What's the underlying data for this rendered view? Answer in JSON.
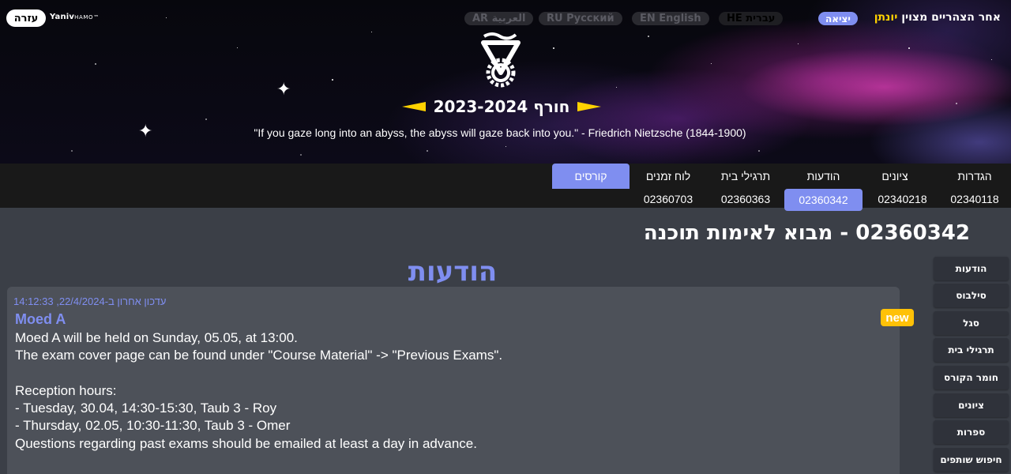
{
  "header": {
    "help_label": "עזרה",
    "creator_name": "Yaniv",
    "creator_sub": "HAMO",
    "creator_mark": "™",
    "languages": [
      {
        "label": "AR العربية",
        "active": false
      },
      {
        "label": "RU Русский",
        "active": false
      },
      {
        "label": "EN English",
        "active": false
      },
      {
        "label": "HE עברית",
        "active": true
      }
    ],
    "logout_label": "יציאה",
    "greeting_prefix": "אחר הצהריים מצוין",
    "user_name": "יונתן",
    "semester_title": "חורף 2023-2024",
    "quote": "\"If you gaze long into an abyss, the abyss will gaze back into you.\" - Friedrich Nietzsche (1844-1900)"
  },
  "nav": {
    "courses_label": "קורסים",
    "top_items": [
      "הגדרות",
      "ציונים",
      "הודעות",
      "תרגילי בית",
      "לוח זמנים"
    ],
    "course_numbers": [
      "02340118",
      "02340218",
      "02360342",
      "02360363",
      "02360703"
    ],
    "active_course": "02360342"
  },
  "course": {
    "title": "02360342 - מבוא לאימות תוכנה"
  },
  "sidebar": {
    "items": [
      "הודעות",
      "סילבוס",
      "סגל",
      "תרגילי בית",
      "חומר הקורס",
      "ציונים",
      "ספרות",
      "חיפוש שותפים"
    ]
  },
  "announcements": {
    "heading": "הודעות",
    "new_badge": "new",
    "items": [
      {
        "updated": "עדכון אחרון ב-22/4/2024, 14:12:33",
        "title": "Moed A",
        "lines": [
          "Moed A will be held on Sunday, 05.05, at 13:00.",
          "The exam cover page can be found under \"Course Material\" -> \"Previous Exams\".",
          "",
          "Reception hours:",
          "- Tuesday, 30.04, 14:30-15:30, Taub 3 - Roy",
          "- Thursday, 02.05, 10:30-11:30, Taub 3 - Omer",
          "Questions regarding past exams should be emailed at least a day in advance."
        ]
      }
    ]
  },
  "colors": {
    "accent": "#7f8ef0",
    "highlight": "#ffd200",
    "new_badge": "#ffc107",
    "card_bg": "#4d5159",
    "page_bg": "#3b3f47",
    "nav_bg": "#191919"
  }
}
